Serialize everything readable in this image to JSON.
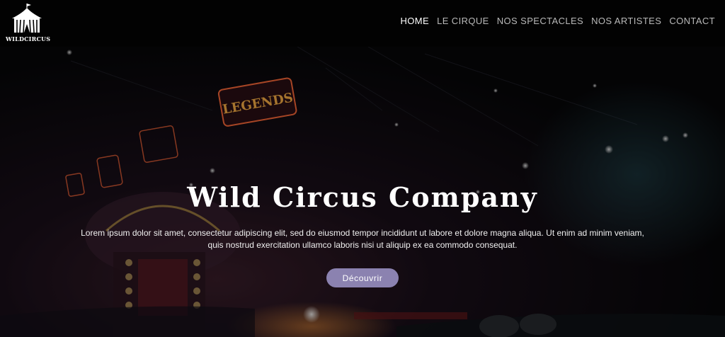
{
  "brand": {
    "name": "WILDCIRCUS",
    "icon": "circus-tent-icon"
  },
  "nav": {
    "items": [
      {
        "label": "HOME",
        "active": true
      },
      {
        "label": "LE CIRQUE",
        "active": false
      },
      {
        "label": "NOS SPECTACLES",
        "active": false
      },
      {
        "label": "NOS ARTISTES",
        "active": false
      },
      {
        "label": "CONTACT",
        "active": false
      }
    ]
  },
  "hero": {
    "title": "Wild Circus Company",
    "text": "Lorem ipsum dolor sit amet, consectetur adipiscing elit, sed do eiusmod tempor incididunt ut labore et dolore magna aliqua. Ut enim ad minim veniam, quis nostrud exercitation ullamco laboris nisi ut aliquip ex ea commodo consequat.",
    "button_label": "Découvrir",
    "sign_text": "LEGENDS"
  },
  "colors": {
    "accent": "#8b82b0",
    "nav_bg": "#020202"
  }
}
